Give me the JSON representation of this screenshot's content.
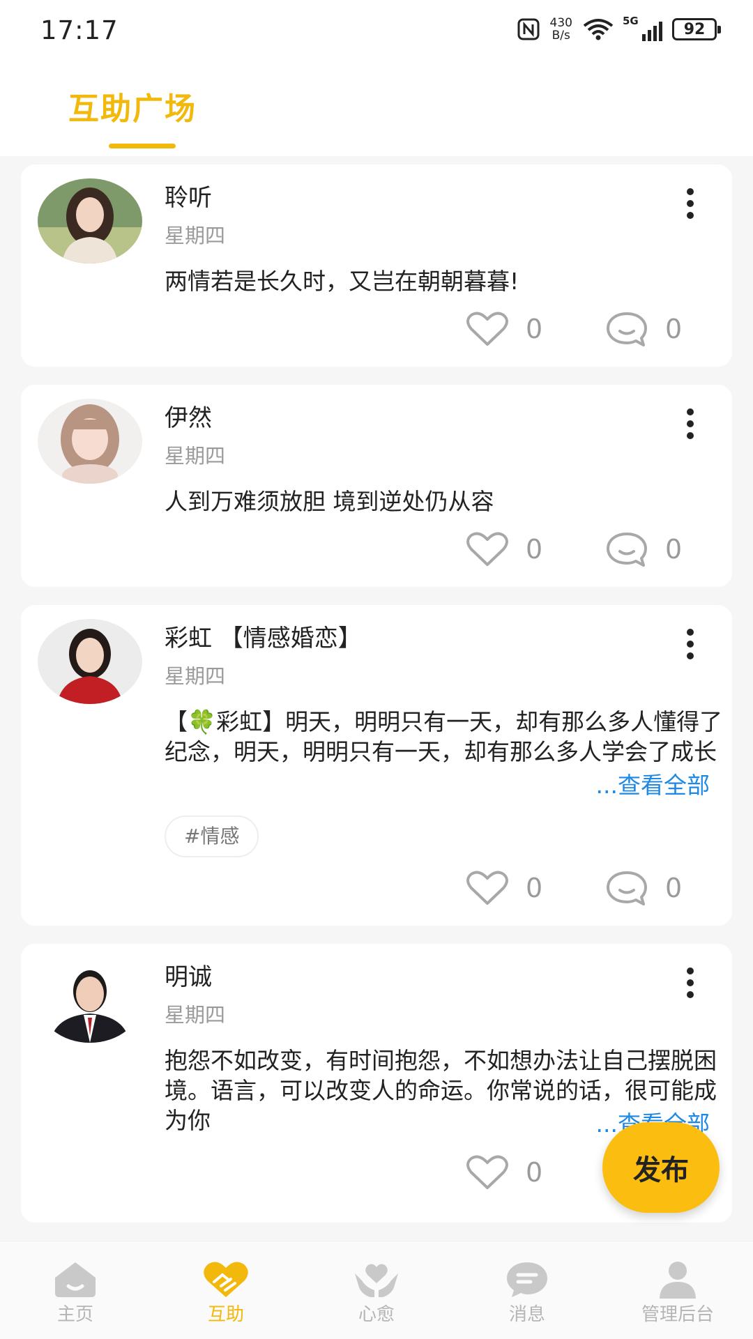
{
  "status_bar": {
    "time": "17:17",
    "net_speed_value": "430",
    "net_speed_unit": "B/s",
    "network": "5G",
    "battery": "92"
  },
  "header": {
    "active_tab": "互助广场",
    "accent_color": "#f2b90c"
  },
  "posts": [
    {
      "author": "聆听",
      "date": "星期四",
      "text": "两情若是长久时，又岂在朝朝暮暮!",
      "likes": "0",
      "comments": "0",
      "avatar_icon": "woman-portrait"
    },
    {
      "author": "伊然",
      "date": "星期四",
      "text": "人到万难须放胆 境到逆处仍从容",
      "likes": "0",
      "comments": "0",
      "avatar_icon": "woman-portrait"
    },
    {
      "author": "彩虹 【情感婚恋】",
      "date": "星期四",
      "text": "【🍀彩虹】明天，明明只有一天，却有那么多人懂得了纪念，明天，明明只有一天，却有那么多人学会了成长",
      "see_all": "...查看全部",
      "tag": "#情感",
      "likes": "0",
      "comments": "0",
      "avatar_icon": "woman-portrait"
    },
    {
      "author": "明诚",
      "date": "星期四",
      "text": "抱怨不如改变，有时间抱怨，不如想办法让自己摆脱困境。语言，可以改变人的命运。你常说的话，很可能成为你",
      "see_all": "...查看全部",
      "likes": "0",
      "avatar_icon": "man-portrait"
    }
  ],
  "publish_button": "发布",
  "bottom_nav": [
    {
      "label": "主页",
      "icon": "home-icon"
    },
    {
      "label": "互助",
      "icon": "handshake-heart-icon",
      "active": true
    },
    {
      "label": "心愈",
      "icon": "hands-heart-icon"
    },
    {
      "label": "消息",
      "icon": "chat-bubble-icon"
    },
    {
      "label": "管理后台",
      "icon": "person-icon"
    }
  ]
}
